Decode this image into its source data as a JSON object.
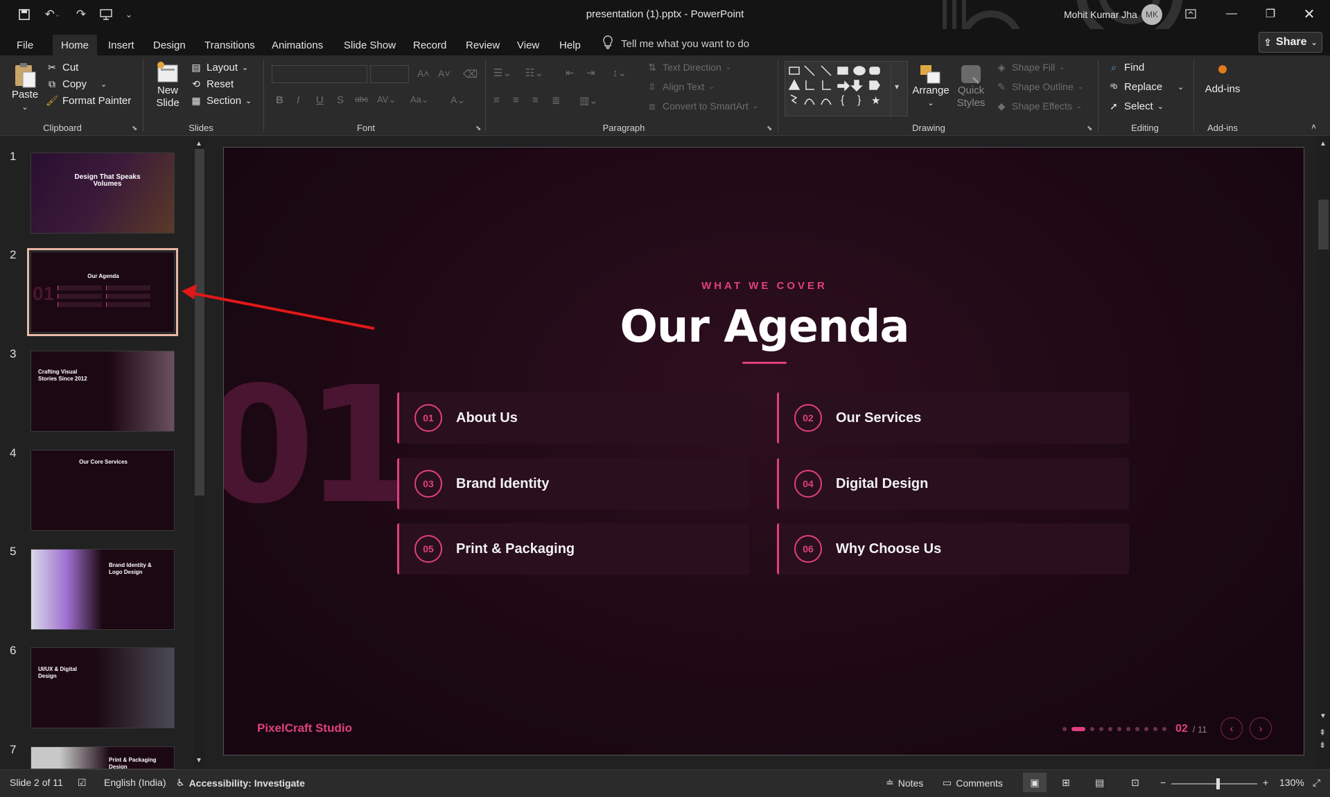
{
  "window": {
    "title": "presentation (1).pptx  -  PowerPoint",
    "user_name": "Mohit Kumar Jha",
    "user_initials": "MK"
  },
  "tabs": [
    "File",
    "Home",
    "Insert",
    "Design",
    "Transitions",
    "Animations",
    "Slide Show",
    "Record",
    "Review",
    "View",
    "Help"
  ],
  "active_tab": "Home",
  "tell_me": "Tell me what you want to do",
  "share_label": "Share",
  "clipboard": {
    "paste": "Paste",
    "cut": "Cut",
    "copy": "Copy",
    "format_painter": "Format Painter",
    "label": "Clipboard"
  },
  "slides_group": {
    "new_slide_1": "New",
    "new_slide_2": "Slide",
    "layout": "Layout",
    "reset": "Reset",
    "section": "Section",
    "label": "Slides"
  },
  "font_group": {
    "label": "Font"
  },
  "paragraph_group": {
    "text_direction": "Text Direction",
    "align_text": "Align Text",
    "convert_smartart": "Convert to SmartArt",
    "label": "Paragraph"
  },
  "drawing_group": {
    "arrange": "Arrange",
    "quick_styles_1": "Quick",
    "quick_styles_2": "Styles",
    "shape_fill": "Shape Fill",
    "shape_outline": "Shape Outline",
    "shape_effects": "Shape Effects",
    "label": "Drawing"
  },
  "editing_group": {
    "find": "Find",
    "replace": "Replace",
    "select": "Select",
    "label": "Editing"
  },
  "addins_group": {
    "addins": "Add-ins",
    "label": "Add-ins"
  },
  "thumbnails": [
    {
      "num": "1",
      "title": "Design That Speaks Volumes"
    },
    {
      "num": "2",
      "title": "Our Agenda"
    },
    {
      "num": "3",
      "title": "Crafting Visual Stories Since 2012"
    },
    {
      "num": "4",
      "title": "Our Core Services"
    },
    {
      "num": "5",
      "title": "Brand Identity & Logo Design"
    },
    {
      "num": "6",
      "title": "UI/UX & Digital Design"
    },
    {
      "num": "7",
      "title": "Print & Packaging Design"
    }
  ],
  "slide": {
    "eyebrow": "WHAT WE COVER",
    "title": "Our Agenda",
    "big_number": "01",
    "items": [
      {
        "num": "01",
        "label": "About Us"
      },
      {
        "num": "02",
        "label": "Our Services"
      },
      {
        "num": "03",
        "label": "Brand Identity"
      },
      {
        "num": "04",
        "label": "Digital Design"
      },
      {
        "num": "05",
        "label": "Print & Packaging"
      },
      {
        "num": "06",
        "label": "Why Choose Us"
      }
    ],
    "brand": "PixelCraft Studio",
    "page_current": "02",
    "page_total": "/ 11",
    "accent": "#e0407f"
  },
  "status": {
    "slide_info": "Slide 2 of 11",
    "language": "English (India)",
    "accessibility": "Accessibility: Investigate",
    "notes": "Notes",
    "comments": "Comments",
    "zoom": "130%"
  }
}
